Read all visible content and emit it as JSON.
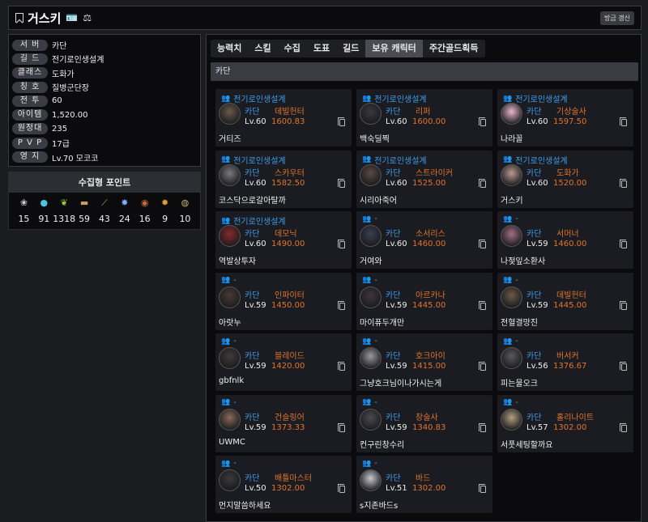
{
  "header": {
    "title": "거스키",
    "refresh_label": "방금 갱신"
  },
  "info": [
    {
      "label": "서 버",
      "value": "카단"
    },
    {
      "label": "길 드",
      "value": "전기로인생설계"
    },
    {
      "label": "클래스",
      "value": "도화가"
    },
    {
      "label": "칭 호",
      "value": "질병군단장"
    },
    {
      "label": "전 투",
      "value": "60"
    },
    {
      "label": "아이템",
      "value": "1,520.00"
    },
    {
      "label": "원정대",
      "value": "235"
    },
    {
      "label": "P V P",
      "value": "17급"
    },
    {
      "label": "영 지",
      "value": "Lv.70 모코코"
    }
  ],
  "collection": {
    "title": "수집형 포인트",
    "items": [
      {
        "icon": "seed-icon",
        "value": "15",
        "color": "#cfcfcf"
      },
      {
        "icon": "island-heart-icon",
        "value": "91",
        "color": "#4fc3e0"
      },
      {
        "icon": "mokoko-seed-icon",
        "value": "1318",
        "color": "#9acd32"
      },
      {
        "icon": "art-icon",
        "value": "59",
        "color": "#c9a060"
      },
      {
        "icon": "giant-heart-icon",
        "value": "43",
        "color": "#d4a84c"
      },
      {
        "icon": "star-icon",
        "value": "24",
        "color": "#7fb3ff"
      },
      {
        "icon": "ignea-icon",
        "value": "16",
        "color": "#c07040"
      },
      {
        "icon": "orpheus-icon",
        "value": "9",
        "color": "#e0a040"
      },
      {
        "icon": "world-tree-icon",
        "value": "10",
        "color": "#c8b070"
      }
    ]
  },
  "tabs": [
    {
      "label": "능력치",
      "active": false
    },
    {
      "label": "스킬",
      "active": false
    },
    {
      "label": "수집",
      "active": false
    },
    {
      "label": "도표",
      "active": false
    },
    {
      "label": "길드",
      "active": false
    },
    {
      "label": "보유 캐릭터",
      "active": true
    },
    {
      "label": "주간골드획득",
      "active": false
    }
  ],
  "server_bar": "카단",
  "characters": [
    {
      "guild": "전기로인생설계",
      "server": "카단",
      "class": "데빌헌터",
      "level": "Lv.60",
      "ilvl": "1600.83",
      "name": "거티즈",
      "avatar": "#6b5a4a"
    },
    {
      "guild": "전기로인생설계",
      "server": "카단",
      "class": "리퍼",
      "level": "Lv.60",
      "ilvl": "1600.00",
      "name": "백숙딜찍",
      "avatar": "#3a3a3e"
    },
    {
      "guild": "전기로인생설계",
      "server": "카단",
      "class": "기상술사",
      "level": "Lv.60",
      "ilvl": "1597.50",
      "name": "나라꼴",
      "avatar": "#e8b8c8"
    },
    {
      "guild": "전기로인생설계",
      "server": "카단",
      "class": "스카우터",
      "level": "Lv.60",
      "ilvl": "1582.50",
      "name": "코스닥으로갈아탈까",
      "avatar": "#7a7a80"
    },
    {
      "guild": "전기로인생설계",
      "server": "카단",
      "class": "스트라이커",
      "level": "Lv.60",
      "ilvl": "1525.00",
      "name": "시리아죽어",
      "avatar": "#5a4a40"
    },
    {
      "guild": "전기로인생설계",
      "server": "카단",
      "class": "도화가",
      "level": "Lv.60",
      "ilvl": "1520.00",
      "name": "거스키",
      "avatar": "#b89a90"
    },
    {
      "guild": "전기로인생설계",
      "server": "카단",
      "class": "데모닉",
      "level": "Lv.60",
      "ilvl": "1490.00",
      "name": "역발상투자",
      "avatar": "#8a2a2a"
    },
    {
      "guild": "-",
      "server": "카단",
      "class": "소서리스",
      "level": "Lv.60",
      "ilvl": "1460.00",
      "name": "거여와",
      "avatar": "#3a4050"
    },
    {
      "guild": "-",
      "server": "카단",
      "class": "서머너",
      "level": "Lv.59",
      "ilvl": "1460.00",
      "name": "나젖잎소환사",
      "avatar": "#a07080"
    },
    {
      "guild": "-",
      "server": "카단",
      "class": "인파이터",
      "level": "Lv.59",
      "ilvl": "1450.00",
      "name": "아랏누",
      "avatar": "#4a3a35"
    },
    {
      "guild": "-",
      "server": "카단",
      "class": "아르카나",
      "level": "Lv.59",
      "ilvl": "1445.00",
      "name": "마이퓨두개만",
      "avatar": "#40363a"
    },
    {
      "guild": "-",
      "server": "카단",
      "class": "데빌헌터",
      "level": "Lv.59",
      "ilvl": "1445.00",
      "name": "전혈결망진",
      "avatar": "#6a5a45"
    },
    {
      "guild": "-",
      "server": "카단",
      "class": "블레이드",
      "level": "Lv.59",
      "ilvl": "1420.00",
      "name": "gbfnlk",
      "avatar": "#3e3a3a"
    },
    {
      "guild": "-",
      "server": "카단",
      "class": "호크아이",
      "level": "Lv.59",
      "ilvl": "1415.00",
      "name": "그냥호크님이나가시는게",
      "avatar": "#9a9aa0"
    },
    {
      "guild": "-",
      "server": "카단",
      "class": "버서커",
      "level": "Lv.56",
      "ilvl": "1376.67",
      "name": "피는물오크",
      "avatar": "#5a5a5e"
    },
    {
      "guild": "-",
      "server": "카단",
      "class": "건슬링어",
      "level": "Lv.59",
      "ilvl": "1373.33",
      "name": "UWMC",
      "avatar": "#8a6a5a"
    },
    {
      "guild": "-",
      "server": "카단",
      "class": "창술사",
      "level": "Lv.59",
      "ilvl": "1340.83",
      "name": "컨구린창수리",
      "avatar": "#4a4a50"
    },
    {
      "guild": "-",
      "server": "카단",
      "class": "홀리나이트",
      "level": "Lv.57",
      "ilvl": "1302.00",
      "name": "서풋세팅할까요",
      "avatar": "#b0a080"
    },
    {
      "guild": "-",
      "server": "카단",
      "class": "배틀마스터",
      "level": "Lv.50",
      "ilvl": "1302.00",
      "name": "먼지말씀하세요",
      "avatar": "#3a3a3a"
    },
    {
      "guild": "-",
      "server": "카단",
      "class": "바드",
      "level": "Lv.51",
      "ilvl": "1302.00",
      "name": "s지존바드s",
      "avatar": "#c8c8d0"
    }
  ]
}
